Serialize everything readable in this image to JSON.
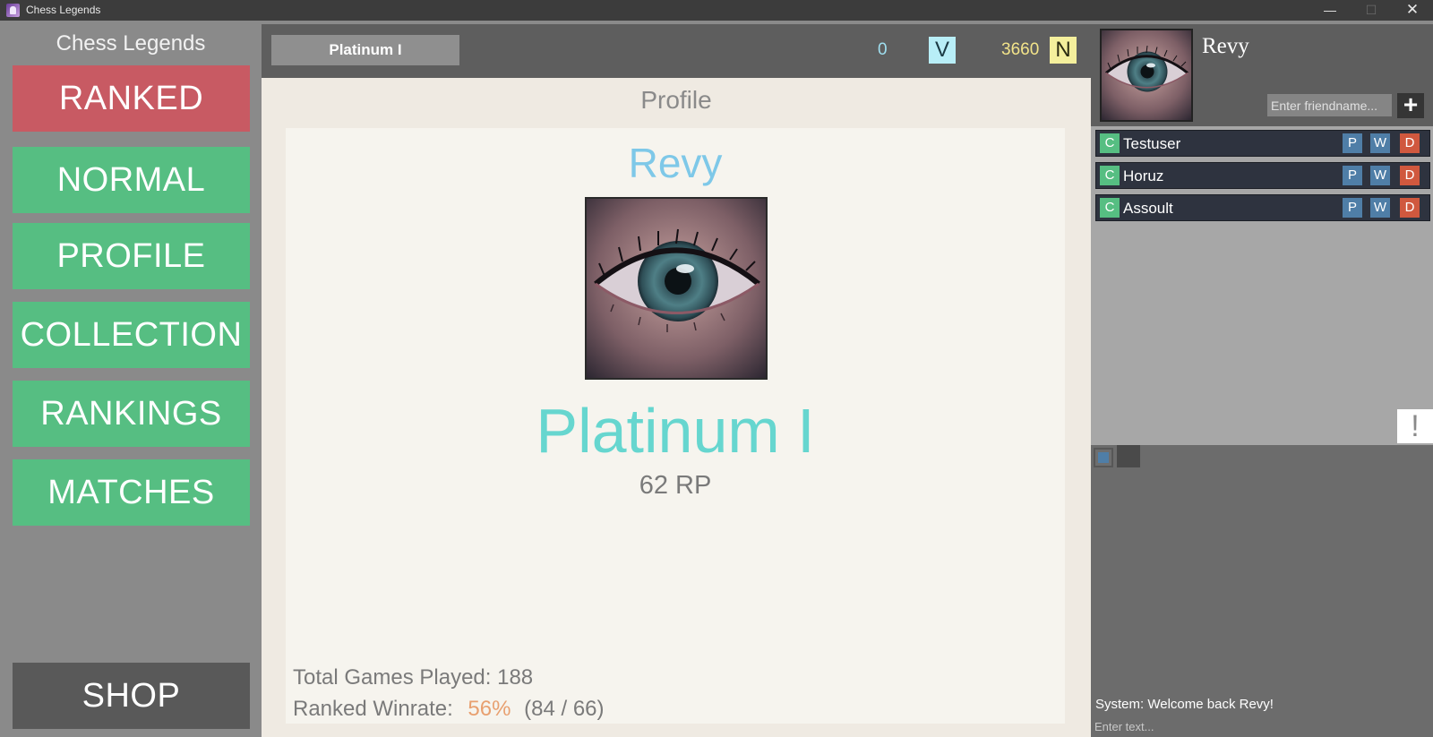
{
  "window": {
    "title": "Chess Legends",
    "min_glyph": "—",
    "max_glyph": "☐",
    "close_glyph": "✕"
  },
  "sidebar": {
    "brand": "Chess Legends",
    "nav": [
      {
        "label": "RANKED"
      },
      {
        "label": "NORMAL"
      },
      {
        "label": "PROFILE"
      },
      {
        "label": "COLLECTION"
      },
      {
        "label": "RANKINGS"
      },
      {
        "label": "MATCHES"
      }
    ],
    "shop": "SHOP"
  },
  "topbar": {
    "rank": "Platinum I",
    "currency_v": {
      "value": "0",
      "symbol": "V"
    },
    "currency_n": {
      "value": "3660",
      "symbol": "N"
    }
  },
  "profile": {
    "section_title": "Profile",
    "username": "Revy",
    "rank": "Platinum I",
    "rp": "62 RP",
    "games_label": "Total Games Played:",
    "games_value": "188",
    "winrate_label": "Ranked Winrate:",
    "winrate_pct": "56%",
    "winrate_record": "(84 / 66)"
  },
  "friends_panel": {
    "username": "Revy",
    "add_placeholder": "Enter friendname...",
    "add_glyph": "+",
    "friends": [
      {
        "name": "Testuser",
        "chat": "C",
        "p": "P",
        "w": "W",
        "d": "D"
      },
      {
        "name": "Horuz",
        "chat": "C",
        "p": "P",
        "w": "W",
        "d": "D"
      },
      {
        "name": "Assoult",
        "chat": "C",
        "p": "P",
        "w": "W",
        "d": "D"
      }
    ],
    "alert": "!"
  },
  "chat": {
    "message": "System: Welcome back Revy!",
    "placeholder": "Enter text..."
  },
  "colors": {
    "ranked": "#c85a63",
    "nav_green": "#56be82",
    "shop": "#595959",
    "username": "#7ec8e8",
    "rank": "#66d6cf",
    "winrate": "#e8a070"
  }
}
